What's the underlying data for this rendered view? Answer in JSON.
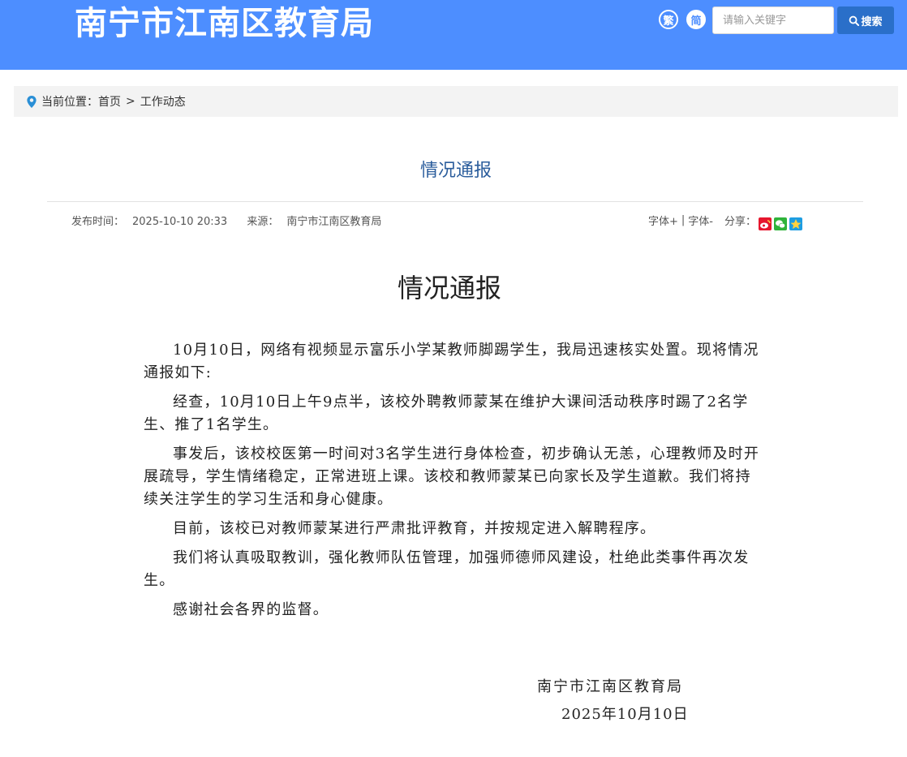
{
  "header": {
    "site_title": "南宁市江南区教育局",
    "traditional_label": "繁",
    "simplified_label": "简",
    "search_placeholder": "请输入关键字",
    "search_button_label": "搜索",
    "icons": [
      "search-icon"
    ]
  },
  "breadcrumb": {
    "prefix": "当前位置：",
    "items": [
      "首页",
      "工作动态"
    ],
    "separator": ">",
    "icon": "location-pin-icon"
  },
  "article": {
    "title": "情况通报",
    "meta": {
      "publish_label": "发布时间：",
      "publish_time": "2025-10-10 20:33",
      "source_label": "来源：",
      "source": "南宁市江南区教育局"
    },
    "tools": {
      "font_increase": "字体+",
      "divider": "|",
      "font_decrease": "字体-",
      "share_label": "分享：",
      "share_icons": [
        "weibo-icon",
        "wechat-icon",
        "qzone-icon"
      ]
    },
    "body_heading": "情况通报",
    "paragraphs": [
      "10月10日，网络有视频显示富乐小学某教师脚踢学生，我局迅速核实处置。现将情况通报如下:",
      "经查，10月10日上午9点半，该校外聘教师蒙某在维护大课间活动秩序时踢了2名学生、推了1名学生。",
      "事发后，该校校医第一时间对3名学生进行身体检查，初步确认无恙，心理教师及时开展疏导，学生情绪稳定，正常进班上课。该校和教师蒙某已向家长及学生道歉。我们将持续关注学生的学习生活和身心健康。",
      "目前，该校已对教师蒙某进行严肃批评教育，并按规定进入解聘程序。",
      "我们将认真吸取教训，强化教师队伍管理，加强师德师风建设，杜绝此类事件再次发生。",
      "感谢社会各界的监督。"
    ],
    "signature_org": "南宁市江南区教育局",
    "signature_date": "2025年10月10日"
  },
  "colors": {
    "header_bg": "#4d8eff",
    "search_button_bg": "#2a6fc9",
    "title_color": "#2b5d9c",
    "breadcrumb_bg": "#f3f3f3"
  }
}
